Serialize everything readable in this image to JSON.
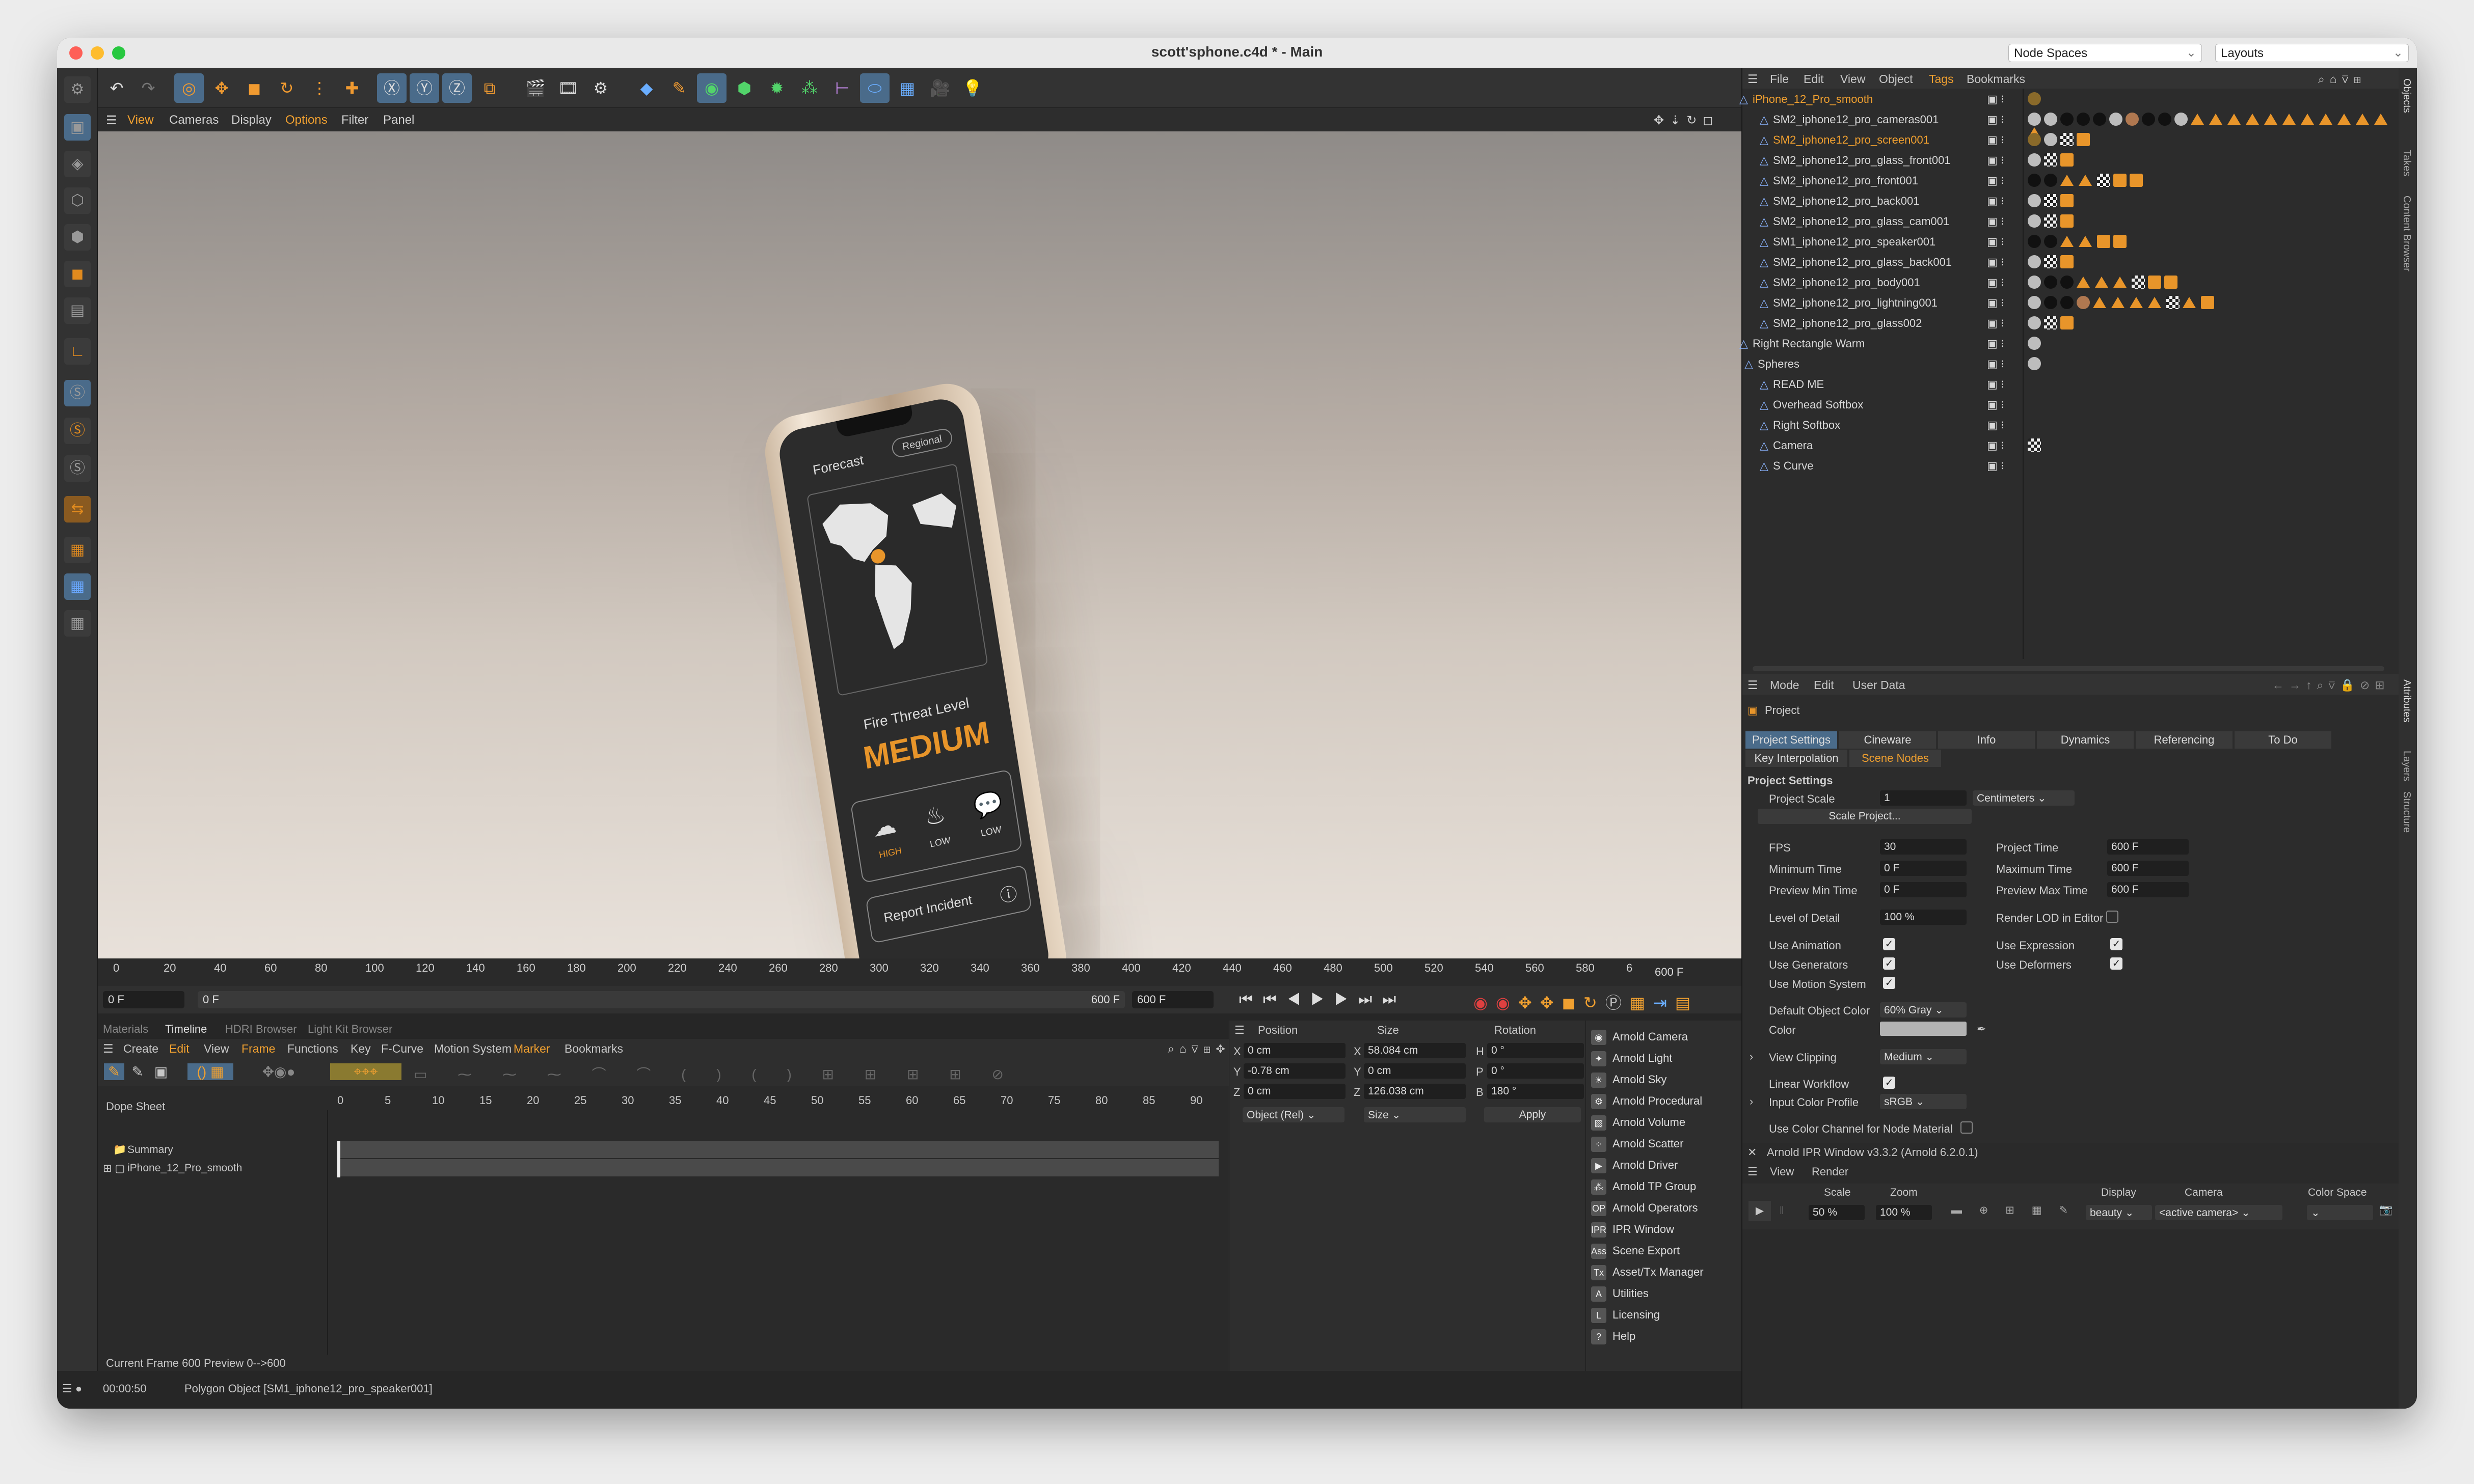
{
  "window": {
    "title": "scott'sphone.c4d * - Main",
    "node_spaces": "Node Spaces",
    "layouts": "Layouts"
  },
  "viewport_menu": [
    "View",
    "Cameras",
    "Display",
    "Options",
    "Filter",
    "Panel"
  ],
  "phone_ui": {
    "tab_left": "Forecast",
    "tab_right": "Regional",
    "fire_label": "Fire Threat Level",
    "level": "MEDIUM",
    "icons": [
      {
        "label": "HIGH"
      },
      {
        "label": "LOW"
      },
      {
        "label": "LOW"
      }
    ],
    "report": "Report Incident"
  },
  "ruler": {
    "ticks": [
      "0",
      "20",
      "40",
      "60",
      "80",
      "100",
      "120",
      "140",
      "160",
      "180",
      "200",
      "220",
      "240",
      "260",
      "280",
      "300",
      "320",
      "340",
      "360",
      "380",
      "400",
      "420",
      "440",
      "460",
      "480",
      "500",
      "520",
      "540",
      "560",
      "580",
      "6"
    ],
    "end_frame": "600 F"
  },
  "scrub": {
    "start": "0 F",
    "start2": "0 F",
    "end": "600 F",
    "end2": "600 F"
  },
  "lower_tabs": [
    "Materials",
    "Timeline",
    "HDRI Browser",
    "Light Kit Browser"
  ],
  "timeline": {
    "menu": [
      "Create",
      "Edit",
      "View",
      "Frame",
      "Functions",
      "Key",
      "F-Curve",
      "Motion System",
      "Marker",
      "Bookmarks"
    ],
    "dope_sheet": "Dope Sheet",
    "frames": [
      "0",
      "5",
      "10",
      "15",
      "20",
      "25",
      "30",
      "35",
      "40",
      "45",
      "50",
      "55",
      "60",
      "65",
      "70",
      "75",
      "80",
      "85",
      "90"
    ],
    "tracks": [
      "Summary",
      "iPhone_12_Pro_smooth"
    ],
    "current_frame": "Current Frame  600  Preview  0-->600"
  },
  "coords": {
    "headers": [
      "Position",
      "Size",
      "Rotation"
    ],
    "rows": [
      {
        "axis": "X",
        "pos": "0 cm",
        "saxis": "X",
        "size": "58.084 cm",
        "raxis": "H",
        "rot": "0 °"
      },
      {
        "axis": "Y",
        "pos": "-0.78 cm",
        "saxis": "Y",
        "size": "0 cm",
        "raxis": "P",
        "rot": "0 °"
      },
      {
        "axis": "Z",
        "pos": "0 cm",
        "saxis": "Z",
        "size": "126.038 cm",
        "raxis": "B",
        "rot": "180 °"
      }
    ],
    "mode": "Object (Rel)",
    "size_mode": "Size",
    "apply": "Apply"
  },
  "arnold_menu": [
    {
      "label": "Arnold Camera",
      "icon": "camera-icon"
    },
    {
      "label": "Arnold Light",
      "icon": "light-icon"
    },
    {
      "label": "Arnold Sky",
      "icon": "sky-icon"
    },
    {
      "label": "Arnold Procedural",
      "icon": "procedural-icon"
    },
    {
      "label": "Arnold Volume",
      "icon": "volume-icon"
    },
    {
      "label": "Arnold Scatter",
      "icon": "scatter-icon"
    },
    {
      "label": "Arnold Driver",
      "icon": "driver-icon"
    },
    {
      "label": "Arnold TP Group",
      "icon": "tp-group-icon"
    },
    {
      "label": "Arnold Operators",
      "icon": "operators-icon"
    },
    {
      "label": "IPR Window",
      "icon": "ipr-icon"
    },
    {
      "label": "Scene Export",
      "icon": "export-icon"
    },
    {
      "label": "Asset/Tx Manager",
      "icon": "tx-icon"
    },
    {
      "label": "Utilities",
      "icon": "utilities-icon"
    },
    {
      "label": "Licensing",
      "icon": "licensing-icon"
    },
    {
      "label": "Help",
      "icon": "help-icon"
    }
  ],
  "status": {
    "time": "00:00:50",
    "message": "Polygon Object [SM1_iphone12_pro_speaker001]"
  },
  "objects": {
    "menu": [
      "File",
      "Edit",
      "View",
      "Object",
      "Tags",
      "Bookmarks"
    ],
    "rows": [
      {
        "name": "iPhone_12_Pro_smooth",
        "highlight": true
      },
      {
        "name": "SM2_iphone12_pro_cameras001",
        "highlight": false
      },
      {
        "name": "SM2_iphone12_pro_screen001",
        "highlight": true
      },
      {
        "name": "SM2_iphone12_pro_glass_front001",
        "highlight": false
      },
      {
        "name": "SM2_iphone12_pro_front001",
        "highlight": false
      },
      {
        "name": "SM2_iphone12_pro_back001",
        "highlight": false
      },
      {
        "name": "SM2_iphone12_pro_glass_cam001",
        "highlight": false
      },
      {
        "name": "SM1_iphone12_pro_speaker001",
        "highlight": false
      },
      {
        "name": "SM2_iphone12_pro_glass_back001",
        "highlight": false
      },
      {
        "name": "SM2_iphone12_pro_body001",
        "highlight": false
      },
      {
        "name": "SM2_iphone12_pro_lightning001",
        "highlight": false
      },
      {
        "name": "SM2_iphone12_pro_glass002",
        "highlight": false
      },
      {
        "name": "Right Rectangle Warm",
        "highlight": false
      },
      {
        "name": "Spheres",
        "highlight": false
      },
      {
        "name": "READ ME",
        "highlight": false
      },
      {
        "name": "Overhead Softbox",
        "highlight": false
      },
      {
        "name": "Right Softbox",
        "highlight": false
      },
      {
        "name": "Camera",
        "highlight": false
      },
      {
        "name": "S Curve",
        "highlight": false
      }
    ]
  },
  "right_vtabs": [
    "Objects",
    "Takes",
    "Content Browser"
  ],
  "attr_vtabs": [
    "Attributes",
    "Layers",
    "Structure"
  ],
  "attributes": {
    "menu": [
      "Mode",
      "Edit",
      "User Data"
    ],
    "project": "Project",
    "tabs": [
      "Project Settings",
      "Cineware",
      "Info",
      "Dynamics",
      "Referencing",
      "To Do"
    ],
    "subtabs": [
      "Key Interpolation",
      "Scene Nodes"
    ],
    "section": "Project Settings",
    "project_scale_label": "Project Scale",
    "project_scale": "1",
    "scale_unit": "Centimeters",
    "scale_project": "Scale Project...",
    "fps_label": "FPS",
    "fps": "30",
    "project_time_label": "Project Time",
    "project_time": "600 F",
    "min_time_label": "Minimum Time",
    "min_time": "0 F",
    "max_time_label": "Maximum Time",
    "max_time": "600 F",
    "pmin_label": "Preview Min Time",
    "pmin": "0 F",
    "pmax_label": "Preview Max Time",
    "pmax": "600 F",
    "lod_label": "Level of Detail",
    "lod": "100 %",
    "render_lod": "Render LOD in Editor",
    "use_animation": "Use Animation",
    "use_expression": "Use Expression",
    "use_generators": "Use Generators",
    "use_deformers": "Use Deformers",
    "use_motion": "Use Motion System",
    "default_color_label": "Default Object Color",
    "default_color": "60% Gray",
    "color_label": "Color",
    "view_clipping_label": "View Clipping",
    "view_clipping": "Medium",
    "linear_workflow": "Linear Workflow",
    "input_profile_label": "Input Color Profile",
    "input_profile": "sRGB",
    "use_channel": "Use Color Channel for Node Material"
  },
  "ipr": {
    "title": "Arnold IPR Window v3.3.2 (Arnold 6.2.0.1)",
    "menu": [
      "View",
      "Render"
    ],
    "scale_label": "Scale",
    "scale": "50 %",
    "zoom_label": "Zoom",
    "zoom": "100 %",
    "display_label": "Display",
    "display": "beauty",
    "camera_label": "Camera",
    "camera": "<active camera>",
    "color_space_label": "Color Space"
  },
  "colors": {
    "accent_orange": "#e8952a",
    "selection_blue": "#4a6b8a",
    "highlight_text": "#f0a030"
  }
}
